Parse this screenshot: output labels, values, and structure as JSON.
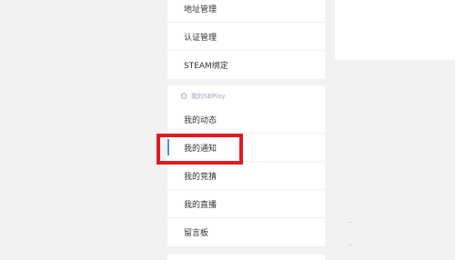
{
  "menu_top": {
    "items": [
      {
        "label": "地址管理"
      },
      {
        "label": "认证管理"
      },
      {
        "label": "STEAM绑定"
      }
    ]
  },
  "menu_mid": {
    "group_title": "我的SEPlay",
    "items": [
      {
        "label": "我的动态"
      },
      {
        "label": "我的通知",
        "active": true
      },
      {
        "label": "我的竞猜"
      },
      {
        "label": "我的直播"
      },
      {
        "label": "留言板"
      }
    ]
  },
  "colors": {
    "background": "#f2f2f2",
    "card": "#ffffff",
    "highlight": "#e01b24",
    "active_indicator": "#4a90e2"
  }
}
